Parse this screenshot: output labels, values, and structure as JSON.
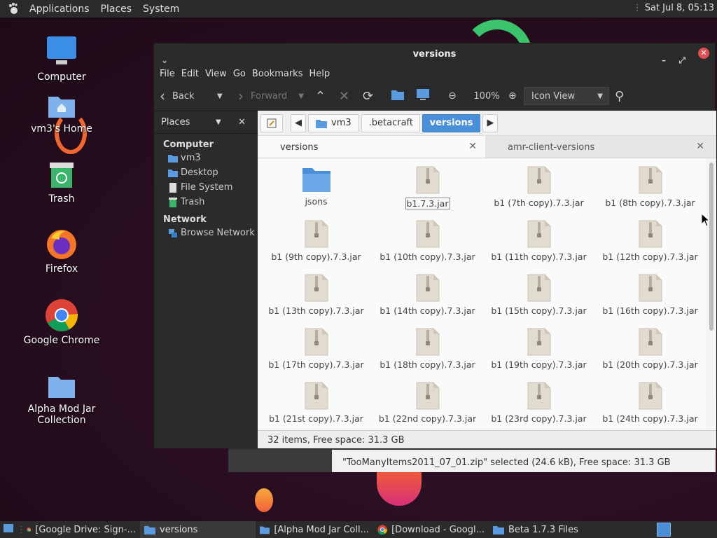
{
  "top_panel": {
    "menus": [
      "Applications",
      "Places",
      "System"
    ],
    "clock": "Sat Jul 8, 05:13"
  },
  "desktop": {
    "icons": [
      {
        "label": "Computer",
        "icon": "monitor-icon"
      },
      {
        "label": "vm3's Home",
        "icon": "home-folder-icon"
      },
      {
        "label": "Trash",
        "icon": "trash-icon"
      },
      {
        "label": "Firefox",
        "icon": "firefox-icon"
      },
      {
        "label": "Google Chrome",
        "icon": "chrome-icon"
      },
      {
        "label": "Alpha Mod Jar Collection",
        "icon": "folder-icon"
      }
    ]
  },
  "back_window": {
    "status": "\"TooManyItems2011_07_01.zip\" selected (24.6 kB), Free space: 31.3 GB"
  },
  "window": {
    "title": "versions",
    "menu": [
      "File",
      "Edit",
      "View",
      "Go",
      "Bookmarks",
      "Help"
    ],
    "toolbar": {
      "back": "Back",
      "forward": "Forward",
      "zoom": "100%",
      "view_mode": "Icon View"
    },
    "sidebar": {
      "header": "Places",
      "sections": [
        {
          "title": "Computer",
          "items": [
            "vm3",
            "Desktop",
            "File System",
            "Trash"
          ]
        },
        {
          "title": "Network",
          "items": [
            "Browse Network"
          ]
        }
      ]
    },
    "path": [
      "vm3",
      ".betacraft",
      "versions"
    ],
    "tabs": [
      {
        "label": "versions",
        "active": true
      },
      {
        "label": "amr-client-versions",
        "active": false
      }
    ],
    "files": [
      {
        "name": "jsons",
        "type": "folder"
      },
      {
        "name": "b1.7.3.jar",
        "type": "jar",
        "selected": true
      },
      {
        "name": "b1 (7th copy).7.3.jar",
        "type": "jar"
      },
      {
        "name": "b1 (8th copy).7.3.jar",
        "type": "jar"
      },
      {
        "name": "b1 (9th copy).7.3.jar",
        "type": "jar"
      },
      {
        "name": "b1 (10th copy).7.3.jar",
        "type": "jar"
      },
      {
        "name": "b1 (11th copy).7.3.jar",
        "type": "jar"
      },
      {
        "name": "b1 (12th copy).7.3.jar",
        "type": "jar"
      },
      {
        "name": "b1 (13th copy).7.3.jar",
        "type": "jar"
      },
      {
        "name": "b1 (14th copy).7.3.jar",
        "type": "jar"
      },
      {
        "name": "b1 (15th copy).7.3.jar",
        "type": "jar"
      },
      {
        "name": "b1 (16th copy).7.3.jar",
        "type": "jar"
      },
      {
        "name": "b1 (17th copy).7.3.jar",
        "type": "jar"
      },
      {
        "name": "b1 (18th copy).7.3.jar",
        "type": "jar"
      },
      {
        "name": "b1 (19th copy).7.3.jar",
        "type": "jar"
      },
      {
        "name": "b1 (20th copy).7.3.jar",
        "type": "jar"
      },
      {
        "name": "b1 (21st copy).7.3.jar",
        "type": "jar"
      },
      {
        "name": "b1 (22nd copy).7.3.jar",
        "type": "jar"
      },
      {
        "name": "b1 (23rd copy).7.3.jar",
        "type": "jar"
      },
      {
        "name": "b1 (24th copy).7.3.jar",
        "type": "jar"
      }
    ],
    "status": "32 items, Free space: 31.3 GB"
  },
  "taskbar": {
    "tasks": [
      {
        "label": "[Google Drive: Sign-...",
        "icon": "chrome-icon",
        "active": false
      },
      {
        "label": "versions",
        "icon": "folder-icon",
        "active": true
      },
      {
        "label": "[Alpha Mod Jar Coll...",
        "icon": "folder-icon",
        "active": false
      },
      {
        "label": "[Download - Googl...",
        "icon": "chrome-icon",
        "active": false
      },
      {
        "label": "Beta 1.7.3 Files",
        "icon": "folder-icon",
        "active": false
      }
    ]
  },
  "colors": {
    "accent": "#4a90d9",
    "panel": "#2b2b2b",
    "close_button": "#e05050"
  }
}
